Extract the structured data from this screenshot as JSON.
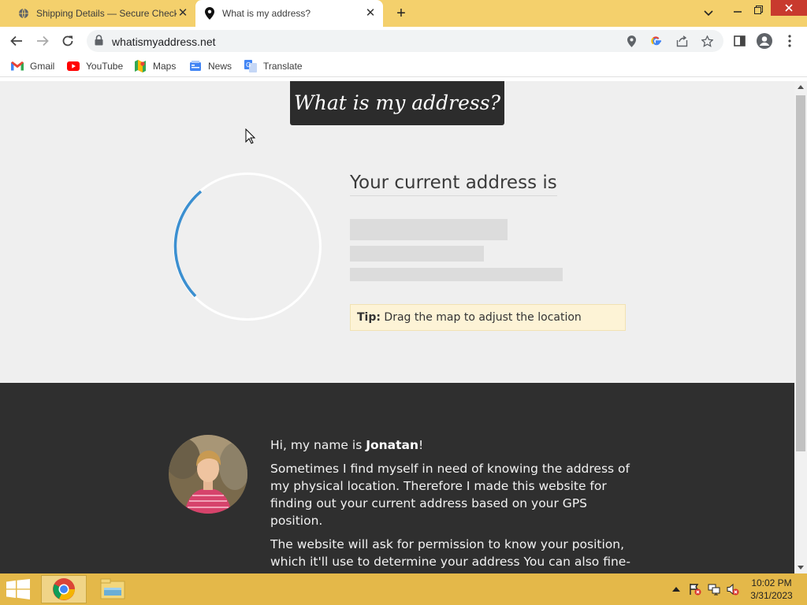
{
  "browser": {
    "tabs": [
      {
        "title": "Shipping Details — Secure Checkout",
        "favicon": "globe-icon",
        "active": false
      },
      {
        "title": "What is my address?",
        "favicon": "location-pin-icon",
        "active": true
      }
    ],
    "url": "whatismyaddress.net",
    "bookmarks": [
      {
        "label": "Gmail",
        "icon": "gmail-icon"
      },
      {
        "label": "YouTube",
        "icon": "youtube-icon"
      },
      {
        "label": "Maps",
        "icon": "maps-icon"
      },
      {
        "label": "News",
        "icon": "news-icon"
      },
      {
        "label": "Translate",
        "icon": "translate-icon"
      }
    ]
  },
  "page": {
    "banner_title": "What is my address?",
    "address_heading": "Your current address is",
    "tip_label": "Tip:",
    "tip_text": " Drag the map to adjust the location",
    "bio": {
      "greeting_prefix": "Hi, my name is ",
      "name": "Jonatan",
      "greeting_suffix": "!",
      "paragraph1": "Sometimes I find myself in need of knowing the address of my physical location. Therefore I made this website for finding out your current address based on your GPS position.",
      "paragraph2": "The website will ask for permission to know your position, which it'll use to determine your address You can also fine-tune the address by dragging the map."
    }
  },
  "taskbar": {
    "time": "10:02 PM",
    "date": "3/31/2023"
  },
  "colors": {
    "tabstrip": "#f4d06c",
    "taskbar": "#e4b849",
    "close_button": "#c83a2e",
    "spinner_arc": "#3b8fd0",
    "dark_section": "#2f2f2f"
  }
}
